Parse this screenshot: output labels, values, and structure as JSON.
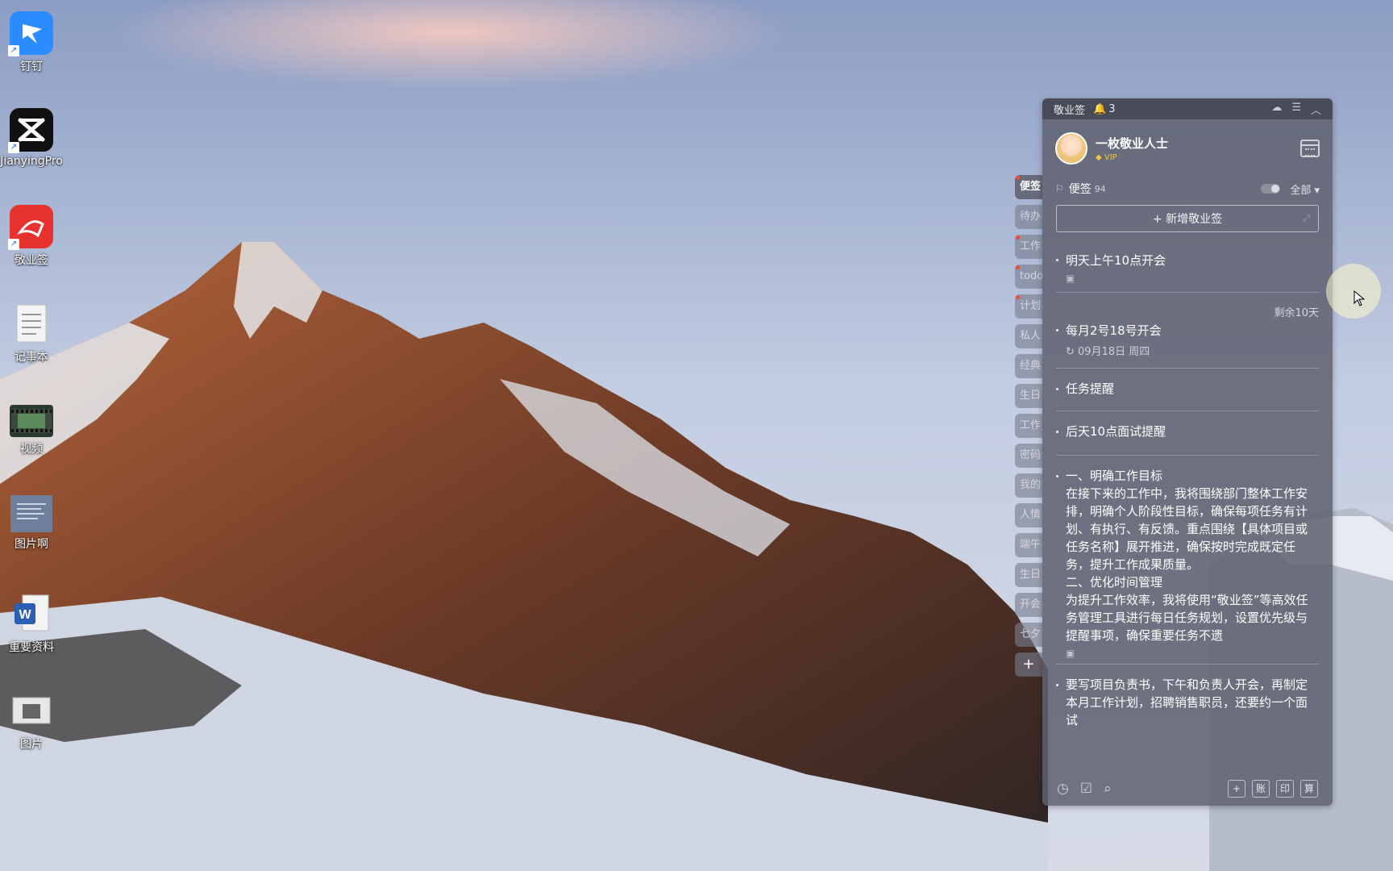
{
  "desktop": {
    "icons": [
      {
        "label": "钉钉",
        "icon": "dingtalk-icon",
        "color": "#2a8cff"
      },
      {
        "label": "JianyingPro",
        "icon": "jianying-icon",
        "color": "#111111"
      },
      {
        "label": "敬业签",
        "icon": "jingyeqian-icon",
        "color": "#e8322d"
      },
      {
        "label": "记事本",
        "icon": "notepad-icon",
        "color": "#f2f2f2"
      },
      {
        "label": "视频",
        "icon": "video-icon",
        "color": "#2b3a2f"
      },
      {
        "label": "图片啊",
        "icon": "image-file-icon",
        "color": "#6d7f9a"
      },
      {
        "label": "重要资料",
        "icon": "word-doc-icon",
        "color": "#2b5fb4"
      },
      {
        "label": "图片",
        "icon": "picture-icon",
        "color": "#e7e7e7"
      }
    ]
  },
  "side_tabs": [
    {
      "label": "便签",
      "active": true,
      "dot": true
    },
    {
      "label": "待办",
      "dot": false
    },
    {
      "label": "工作",
      "dot": true
    },
    {
      "label": "todo",
      "dot": true
    },
    {
      "label": "计划",
      "dot": true
    },
    {
      "label": "私人",
      "dot": false
    },
    {
      "label": "经典",
      "dot": false
    },
    {
      "label": "生日",
      "dot": false
    },
    {
      "label": "工作",
      "dot": false
    },
    {
      "label": "密码",
      "dot": false
    },
    {
      "label": "我的",
      "dot": false
    },
    {
      "label": "人情",
      "dot": false
    },
    {
      "label": "端午",
      "dot": false
    },
    {
      "label": "生日",
      "dot": false
    },
    {
      "label": "开会",
      "dot": false
    },
    {
      "label": "七夕",
      "dot": false
    }
  ],
  "add_tab_label": "+",
  "panel": {
    "app_name": "敬业签",
    "reminder_count": "3",
    "user_name": "一枚敬业人士",
    "vip_label": "VIP",
    "section_title": "便签",
    "section_count": "94",
    "filter_label": "全部",
    "add_button_label": "+ 新增敬业签",
    "notes": [
      {
        "text": "明天上午10点开会",
        "attachment": true
      },
      {
        "text": "每月2号18号开会",
        "remain": "剩余10天",
        "date": "09月18日 周四"
      },
      {
        "text": "任务提醒"
      },
      {
        "text": "后天10点面试提醒"
      },
      {
        "text": "一、明确工作目标\n在接下来的工作中，我将围绕部门整体工作安排，明确个人阶段性目标，确保每项任务有计划、有执行、有反馈。重点围绕【具体项目或任务名称】展开推进，确保按时完成既定任务，提升工作成果质量。\n二、优化时间管理\n为提升工作效率，我将使用“敬业签”等高效任务管理工具进行每日任务规划，设置优先级与提醒事项，确保重要任务不遗",
        "attachment": true
      },
      {
        "text": "要写项目负责书，下午和负责人开会，再制定本月工作计划，招聘销售职员，还要约一个面试"
      }
    ],
    "bottom_buttons": [
      "账",
      "印",
      "算"
    ],
    "accent": "#f14a3a"
  }
}
